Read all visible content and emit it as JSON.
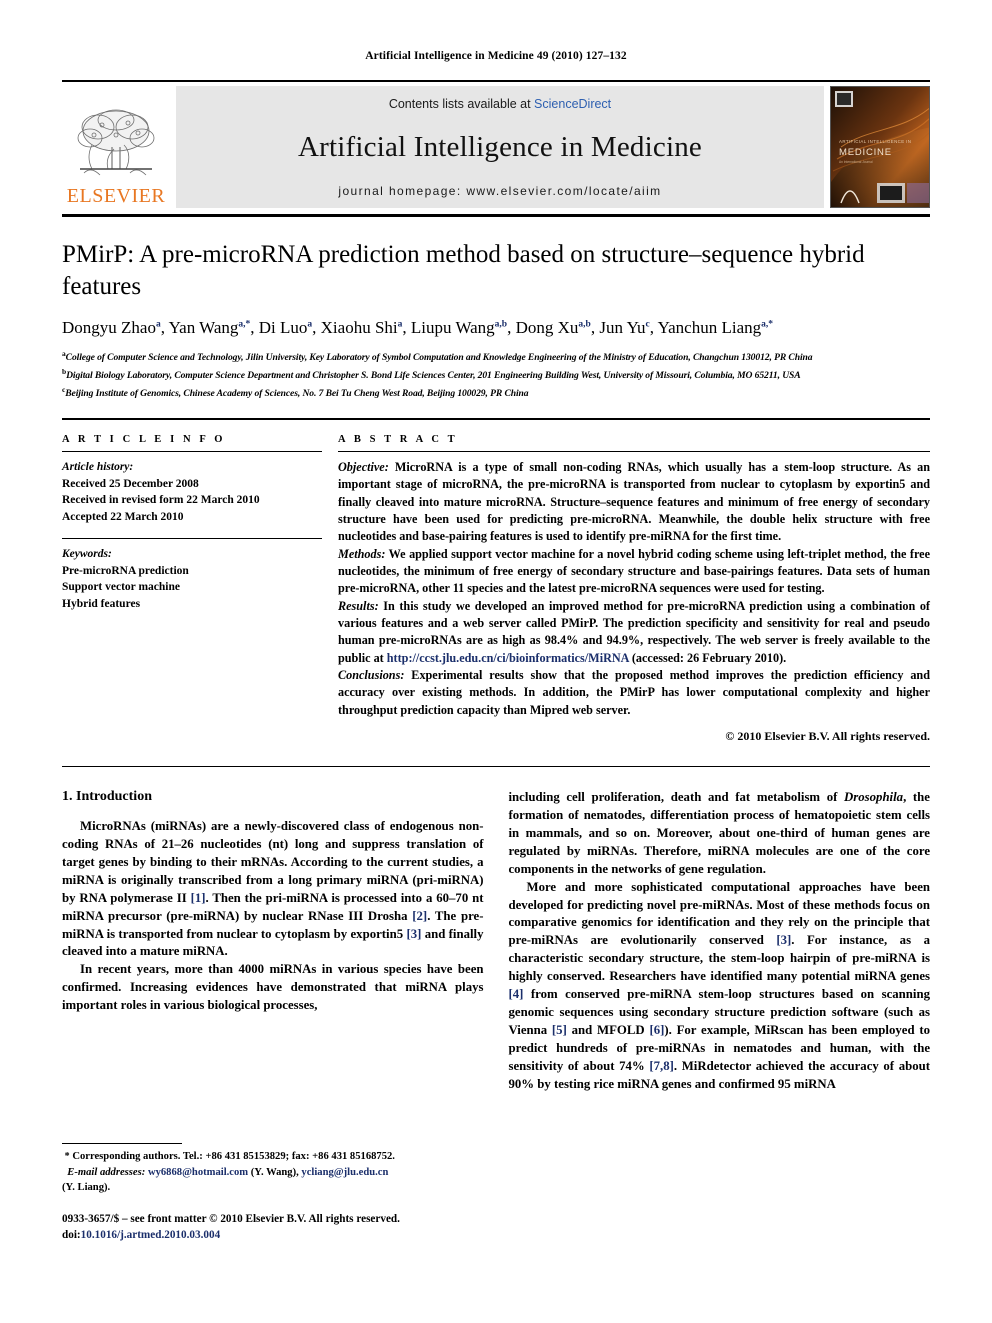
{
  "running_head": "Artificial Intelligence in Medicine 49 (2010) 127–132",
  "masthead": {
    "contents_prefix": "Contents lists available at ",
    "sciencedirect": "ScienceDirect",
    "journal_title": "Artificial Intelligence in Medicine",
    "homepage": "journal homepage: www.elsevier.com/locate/aiim",
    "publisher_wordmark": "ELSEVIER",
    "publisher_logo_icon": "elsevier-tree-logo",
    "cover_thumb_icon": "journal-cover-thumbnail",
    "cover_title_line1": "ARTIFICIAL INTELLIGENCE IN",
    "cover_title_line2": "MEDICINE",
    "accent_orange": "#E87722",
    "link_blue": "#2d5fb0",
    "panel_gray": "#e6e6e6"
  },
  "article": {
    "title": "PMirP: A pre-microRNA prediction method based on structure–sequence hybrid features",
    "authors": [
      {
        "name": "Dongyu Zhao",
        "sup": "a"
      },
      {
        "name": "Yan Wang",
        "sup": "a,*"
      },
      {
        "name": "Di Luo",
        "sup": "a"
      },
      {
        "name": "Xiaohu Shi",
        "sup": "a"
      },
      {
        "name": "Liupu Wang",
        "sup": "a,b"
      },
      {
        "name": "Dong Xu",
        "sup": "a,b"
      },
      {
        "name": "Jun Yu",
        "sup": "c"
      },
      {
        "name": "Yanchun Liang",
        "sup": "a,*"
      }
    ],
    "affiliations": [
      {
        "sup": "a",
        "text": "College of Computer Science and Technology, Jilin University, Key Laboratory of Symbol Computation and Knowledge Engineering of the Ministry of Education, Changchun 130012, PR China"
      },
      {
        "sup": "b",
        "text": "Digital Biology Laboratory, Computer Science Department and Christopher S. Bond Life Sciences Center, 201 Engineering Building West, University of Missouri, Columbia, MO 65211, USA"
      },
      {
        "sup": "c",
        "text": "Beijing Institute of Genomics, Chinese Academy of Sciences, No. 7 Bei Tu Cheng West Road, Beijing 100029, PR China"
      }
    ]
  },
  "article_info": {
    "heading": "A R T I C L E  I N F O",
    "history_label": "Article history:",
    "history": [
      "Received 25 December 2008",
      "Received in revised form 22 March 2010",
      "Accepted 22 March 2010"
    ],
    "keywords_label": "Keywords:",
    "keywords": [
      "Pre-microRNA prediction",
      "Support vector machine",
      "Hybrid features"
    ]
  },
  "abstract": {
    "heading": "A B S T R A C T",
    "objective_label": "Objective:",
    "objective_text": " MicroRNA is a type of small non-coding RNAs, which usually has a stem-loop structure. As an important stage of microRNA, the pre-microRNA is transported from nuclear to cytoplasm by exportin5 and finally cleaved into mature microRNA. Structure–sequence features and minimum of free energy of secondary structure have been used for predicting pre-microRNA. Meanwhile, the double helix structure with free nucleotides and base-pairing features is used to identify pre-miRNA for the first time.",
    "methods_label": "Methods:",
    "methods_text": " We applied support vector machine for a novel hybrid coding scheme using left-triplet method, the free nucleotides, the minimum of free energy of secondary structure and base-pairings features. Data sets of human pre-microRNA, other 11 species and the latest pre-microRNA sequences were used for testing.",
    "results_label": "Results:",
    "results_text_a": " In this study we developed an improved method for pre-microRNA prediction using a combination of various features and a web server called PMirP. The prediction specificity and sensitivity for real and pseudo human pre-microRNAs are as high as 98.4% and 94.9%, respectively. The web server is freely available to the public at ",
    "results_link": "http://ccst.jlu.edu.cn/ci/bioinformatics/MiRNA",
    "results_text_b": " (accessed: 26 February 2010).",
    "conclusions_label": "Conclusions:",
    "conclusions_text": " Experimental results show that the proposed method improves the prediction efficiency and accuracy over existing methods. In addition, the PMirP has lower computational complexity and higher throughput prediction capacity than Mipred web server.",
    "copyright": "© 2010 Elsevier B.V. All rights reserved."
  },
  "body": {
    "section_title": "1. Introduction",
    "left_paragraphs": [
      {
        "parts": [
          {
            "t": "MicroRNAs (miRNAs) are a newly-discovered class of endogenous non-coding RNAs of 21–26 nucleotides (nt) long and suppress translation of target genes by binding to their mRNAs. According to the current studies, a miRNA is originally transcribed from a long primary miRNA (pri-miRNA) by RNA polymerase II "
          },
          {
            "t": "[1]",
            "ref": true
          },
          {
            "t": ". Then the pri-miRNA is processed into a 60–70 nt miRNA precursor (pre-miRNA) by nuclear RNase III Drosha "
          },
          {
            "t": "[2]",
            "ref": true
          },
          {
            "t": ". The pre-miRNA is transported from nuclear to cytoplasm by exportin5 "
          },
          {
            "t": "[3]",
            "ref": true
          },
          {
            "t": " and finally cleaved into a mature miRNA."
          }
        ]
      },
      {
        "parts": [
          {
            "t": "In recent years, more than 4000 miRNAs in various species have been confirmed. Increasing evidences have demonstrated that miRNA plays important roles in various biological processes,"
          }
        ]
      }
    ],
    "right_paragraphs": [
      {
        "parts": [
          {
            "t": "including cell proliferation, death and fat metabolism of ",
            "noindent": true
          },
          {
            "t": "Drosophila",
            "italic": true
          },
          {
            "t": ", the formation of nematodes, differentiation process of hematopoietic stem cells in mammals, and so on. Moreover, about one-third of human genes are regulated by miRNAs. Therefore, miRNA molecules are one of the core components in the networks of gene regulation."
          }
        ]
      },
      {
        "parts": [
          {
            "t": "More and more sophisticated computational approaches have been developed for predicting novel pre-miRNAs. Most of these methods focus on comparative genomics for identification and they rely on the principle that pre-miRNAs are evolutionarily conserved "
          },
          {
            "t": "[3]",
            "ref": true
          },
          {
            "t": ". For instance, as a characteristic secondary structure, the stem-loop hairpin of pre-miRNA is highly conserved. Researchers have identified many potential miRNA genes "
          },
          {
            "t": "[4]",
            "ref": true
          },
          {
            "t": " from conserved pre-miRNA stem-loop structures based on scanning genomic sequences using secondary structure prediction software (such as Vienna "
          },
          {
            "t": "[5]",
            "ref": true
          },
          {
            "t": " and MFOLD "
          },
          {
            "t": "[6]",
            "ref": true
          },
          {
            "t": "). For example, MiRscan has been employed to predict hundreds of pre-miRNAs in nematodes and human, with the sensitivity of about 74% "
          },
          {
            "t": "[7,8]",
            "ref": true
          },
          {
            "t": ". MiRdetector achieved the accuracy of about 90% by testing rice miRNA genes and confirmed 95 miRNA"
          }
        ]
      }
    ]
  },
  "footnotes": {
    "corresponding_star": "*",
    "corresponding_text": "Corresponding authors. Tel.: +86 431 85153829; fax: +86 431 85168752.",
    "email_label": "E-mail addresses:",
    "email_1": "wy6868@hotmail.com",
    "email_1_owner": " (Y. Wang), ",
    "email_2": "ycliang@jlu.edu.cn",
    "email_2_owner": "(Y. Liang).",
    "issn_line": "0933-3657/$ – see front matter © 2010 Elsevier B.V. All rights reserved.",
    "doi_prefix": "doi:",
    "doi_value": "10.1016/j.artmed.2010.03.004"
  }
}
